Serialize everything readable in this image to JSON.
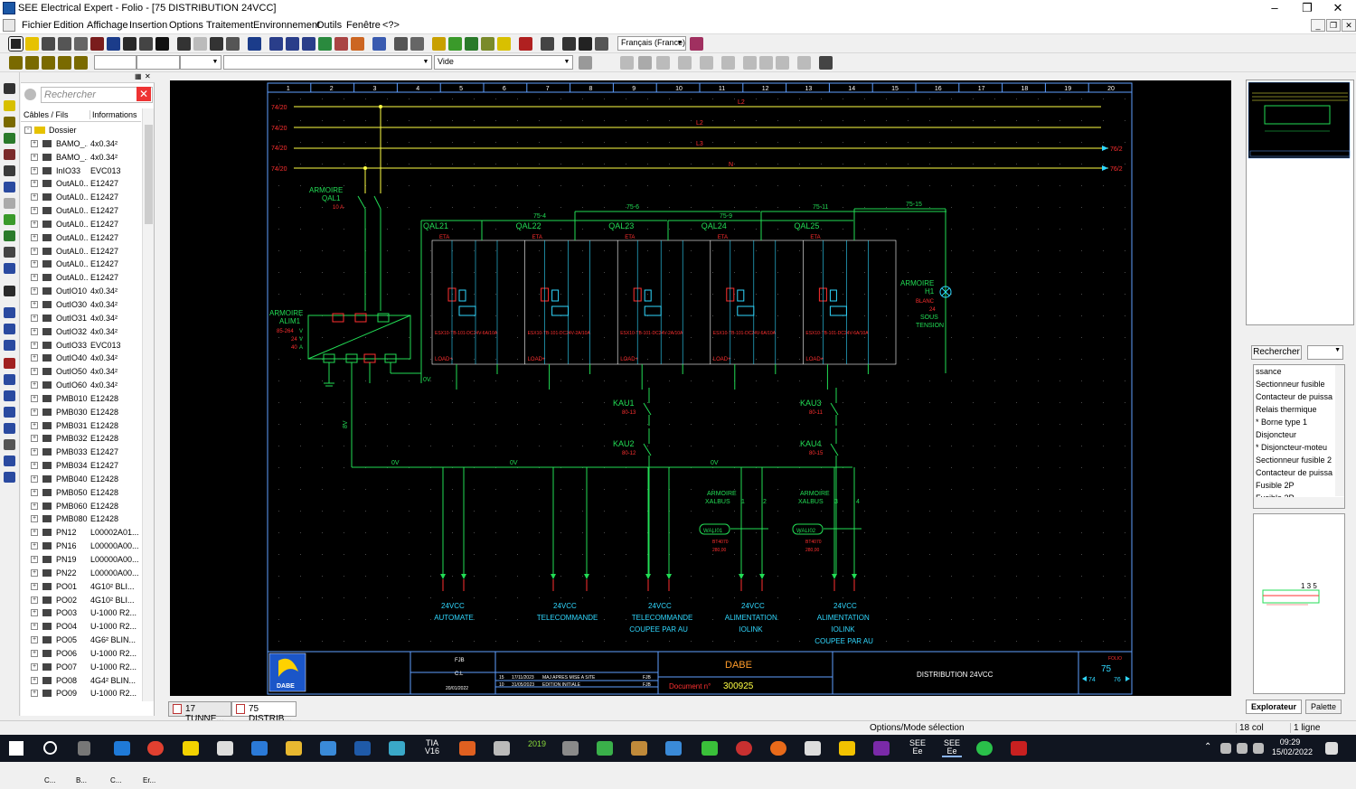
{
  "app": {
    "title": "SEE Electrical Expert - Folio - [75 DISTRIBUTION 24VCC]",
    "menu": [
      "Fichier",
      "Edition",
      "Affichage",
      "Insertion",
      "Options",
      "Traitement",
      "Environnement",
      "Outils",
      "Fenêtre",
      "<?>"
    ],
    "language": "Français (France)",
    "style_combo": "Vide"
  },
  "left_panel": {
    "search_placeholder": "Rechercher",
    "col_cables": "Câbles / Fils",
    "col_info": "Informations",
    "root": "Dossier",
    "rows": [
      {
        "name": "BAMO_...",
        "info": "4x0.34²"
      },
      {
        "name": "BAMO_...",
        "info": "4x0.34²"
      },
      {
        "name": "InIO33",
        "info": "EVC013"
      },
      {
        "name": "OutAL0...",
        "info": "E12427"
      },
      {
        "name": "OutAL0...",
        "info": "E12427"
      },
      {
        "name": "OutAL0...",
        "info": "E12427"
      },
      {
        "name": "OutAL0...",
        "info": "E12427"
      },
      {
        "name": "OutAL0...",
        "info": "E12427"
      },
      {
        "name": "OutAL0...",
        "info": "E12427"
      },
      {
        "name": "OutAL0...",
        "info": "E12427"
      },
      {
        "name": "OutAL0...",
        "info": "E12427"
      },
      {
        "name": "OutIO10",
        "info": "4x0.34²"
      },
      {
        "name": "OutIO30",
        "info": "4x0.34²"
      },
      {
        "name": "OutIO31",
        "info": "4x0.34²"
      },
      {
        "name": "OutIO32",
        "info": "4x0.34²"
      },
      {
        "name": "OutIO33",
        "info": "EVC013"
      },
      {
        "name": "OutIO40",
        "info": "4x0.34²"
      },
      {
        "name": "OutIO50",
        "info": "4x0.34²"
      },
      {
        "name": "OutIO60",
        "info": "4x0.34²"
      },
      {
        "name": "PMB010",
        "info": "E12428"
      },
      {
        "name": "PMB030",
        "info": "E12428"
      },
      {
        "name": "PMB031",
        "info": "E12428"
      },
      {
        "name": "PMB032",
        "info": "E12428"
      },
      {
        "name": "PMB033",
        "info": "E12427"
      },
      {
        "name": "PMB034",
        "info": "E12427"
      },
      {
        "name": "PMB040",
        "info": "E12428"
      },
      {
        "name": "PMB050",
        "info": "E12428"
      },
      {
        "name": "PMB060",
        "info": "E12428"
      },
      {
        "name": "PMB080",
        "info": "E12428"
      },
      {
        "name": "PN12",
        "info": "L00002A01..."
      },
      {
        "name": "PN16",
        "info": "L00000A00..."
      },
      {
        "name": "PN19",
        "info": "L00000A00..."
      },
      {
        "name": "PN22",
        "info": "L00000A00..."
      },
      {
        "name": "PO01",
        "info": "4G10² BLI..."
      },
      {
        "name": "PO02",
        "info": "4G10² BLI..."
      },
      {
        "name": "PO03",
        "info": "U-1000 R2..."
      },
      {
        "name": "PO04",
        "info": "U-1000 R2..."
      },
      {
        "name": "PO05",
        "info": "4G6² BLIN..."
      },
      {
        "name": "PO06",
        "info": "U-1000 R2..."
      },
      {
        "name": "PO07",
        "info": "U-1000 R2..."
      },
      {
        "name": "PO08",
        "info": "4G4² BLIN..."
      },
      {
        "name": "PO09",
        "info": "U-1000 R2..."
      }
    ],
    "bottom_tabs": [
      "C...",
      "B...",
      "C...",
      "Er..."
    ]
  },
  "doc_tabs": [
    "17 TUNNE...",
    "75 DISTRIB..."
  ],
  "sheet": {
    "columns": [
      "1",
      "2",
      "3",
      "4",
      "5",
      "6",
      "7",
      "8",
      "9",
      "10",
      "11",
      "12",
      "13",
      "14",
      "15",
      "16",
      "17",
      "18",
      "19",
      "20"
    ],
    "bus_labels": [
      "74/20",
      "74/20",
      "74/20",
      "74/20",
      "74/20"
    ],
    "bus_names": [
      "L2",
      "L2",
      "L3",
      "N"
    ],
    "bus_refs": [
      "76/2",
      "76/2"
    ],
    "armoire_qal1": [
      "ARMOIRE",
      "QAL1",
      "10 A"
    ],
    "armoire_alim1": [
      "ARMOIRE",
      "ALIM1",
      "85-264",
      "V",
      "24",
      "V",
      "40",
      "A"
    ],
    "breakers": [
      {
        "name": "QAL21",
        "ref": "ESX10-TB-101-DC24V-6A/10A"
      },
      {
        "name": "QAL22",
        "ref": "ESX10-TB-101-DC24V-2A/10A"
      },
      {
        "name": "QAL23",
        "ref": "ESX10-TB-101-DC24V-2A/10A"
      },
      {
        "name": "QAL24",
        "ref": "ESX10-TB-101-DC24V-6A/10A"
      },
      {
        "name": "QAL25",
        "ref": "ESX10-TB-101-DC24V-6A/10A"
      }
    ],
    "wires_top": [
      "75-4",
      "75-6",
      "75-9",
      "75-11",
      "75-15"
    ],
    "armoire_h1": [
      "ARMOIRE",
      "H1",
      "BLANC",
      "24",
      "SOUS",
      "TENSION"
    ],
    "relays": [
      {
        "name": "KAU1",
        "ref": "80-13"
      },
      {
        "name": "KAU2",
        "ref": "80-12"
      },
      {
        "name": "KAU3",
        "ref": "80-11"
      },
      {
        "name": "KAU4",
        "ref": "80-15"
      }
    ],
    "xalbus": [
      {
        "label": "ARMOIRE",
        "name": "XALBUS",
        "pins": [
          "1",
          "2"
        ],
        "wago": "WALI01",
        "wago_ref": "BT4070",
        "extra": "280,00"
      },
      {
        "label": "ARMOIRE",
        "name": "XALBUS",
        "pins": [
          "3",
          "4"
        ],
        "wago": "WALI02",
        "wago_ref": "BT4070",
        "extra": "280,00"
      }
    ],
    "outputs": [
      {
        "lines": [
          "24VCC",
          "AUTOMATE"
        ]
      },
      {
        "lines": [
          "24VCC",
          "TELECOMMANDE"
        ]
      },
      {
        "lines": [
          "24VCC",
          "TELECOMMANDE",
          "COUPEE PAR AU"
        ]
      },
      {
        "lines": [
          "24VCC",
          "ALIMENTATION",
          "IOLINK"
        ]
      },
      {
        "lines": [
          "24VCC",
          "ALIMENTATION",
          "IOLINK",
          "COUPEE PAR AU"
        ]
      }
    ],
    "wire_0v": "0V",
    "wire_8v": "8V",
    "cartouche": {
      "company": "DABE",
      "logo_text": "DABE",
      "title": "DISTRIBUTION 24VCC",
      "doc_label": "Document n°",
      "doc_number": "300925",
      "folio_label": "FOLIO",
      "folio": "75",
      "prev": "74",
      "next": "76",
      "rev_rows": [
        {
          "ind": "15",
          "date": "17/11/2023",
          "text": "MAJ APRES MISE A SITE",
          "who": "FJB"
        },
        {
          "ind": "10",
          "date": "31/05/2023",
          "text": "EDITION INITIALE",
          "who": "FJB"
        }
      ],
      "drawn": "FJB",
      "checked": "C.L",
      "date": "20/01/2022"
    }
  },
  "right_panel": {
    "search_btn": "Rechercher",
    "items": [
      "ssance",
      "Sectionneur fusible",
      "Contacteur de puissa",
      "Relais thermique",
      "* Borne type 1",
      "Disjoncteur",
      "* Disjoncteur-moteu",
      "Sectionneur fusible 2",
      "Contacteur de puissa",
      "Fusible 2P",
      "Fusible 3P"
    ],
    "tabs": [
      "Explorateur",
      "Palette"
    ]
  },
  "status": {
    "mode": "Options/Mode sélection",
    "col": "18 col",
    "line": "1 ligne"
  },
  "taskbar": {
    "time": "09:29",
    "date": "15/02/2022",
    "app_labels": [
      "TIA\nV16",
      "2019",
      "SEE\nEe",
      "SEE\nEe"
    ]
  },
  "colors": {
    "schematic_bg": "#000000",
    "frame": "#5f9fff",
    "green": "#22dd55",
    "yellow": "#ffff44",
    "red": "#ff3030",
    "cyan": "#30d8ff"
  }
}
